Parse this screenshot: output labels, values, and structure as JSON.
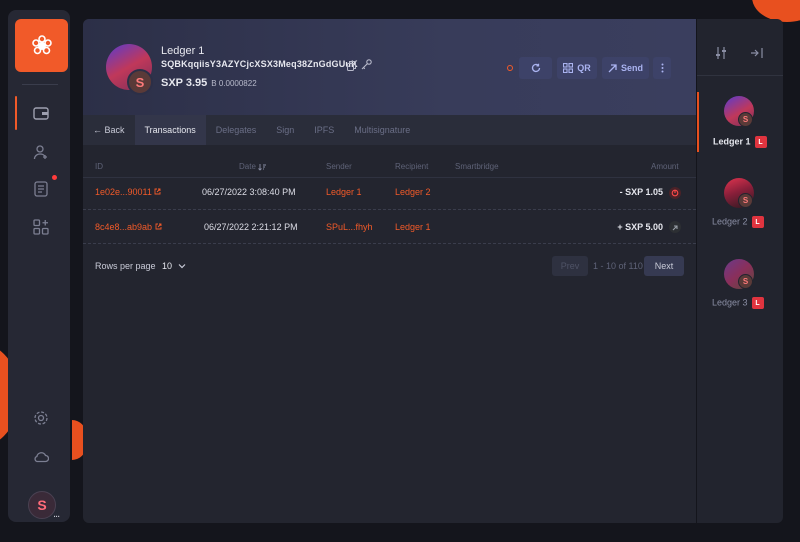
{
  "colors": {
    "accent": "#f15a29",
    "badge_red": "#e0343f",
    "button_bg": "#3d4268"
  },
  "wallet": {
    "name": "Ledger 1",
    "address": "SQBKqqiisY3AZYCjcXSX3Meq38ZnGdGUuK",
    "balance": "SXP 3.95",
    "btc": "B 0.0000822",
    "avatar_letter": "S"
  },
  "header_buttons": {
    "refresh_icon": "refresh-icon",
    "qr": "QR",
    "send": "Send",
    "more_icon": "more-vertical-icon"
  },
  "tabs": [
    {
      "label": "← Back"
    },
    {
      "label": "Transactions"
    },
    {
      "label": "Delegates"
    },
    {
      "label": "Sign"
    },
    {
      "label": "IPFS"
    },
    {
      "label": "Multisignature"
    }
  ],
  "table": {
    "headers": {
      "id": "ID",
      "date": "Date",
      "sender": "Sender",
      "recipient": "Recipient",
      "smartbridge": "Smartbridge",
      "amount": "Amount"
    },
    "rows": [
      {
        "id": "1e02e...90011",
        "date": "06/27/2022 3:08:40 PM",
        "sender": "Ledger 1",
        "recipient": "Ledger 2",
        "amount": "- SXP 1.05"
      },
      {
        "id": "8c4e8...ab9ab",
        "date": "06/27/2022 2:21:12 PM",
        "sender": "SPuL...fhyh",
        "recipient": "Ledger 1",
        "amount": "+ SXP 5.00"
      }
    ]
  },
  "pagination": {
    "rows_label": "Rows per page",
    "rows_value": "10",
    "prev": "Prev",
    "info": "1 - 10 of 110",
    "next": "Next"
  },
  "sidebar_user": {
    "letter": "S",
    "more": "..."
  },
  "wallets": [
    {
      "label": "Ledger 1",
      "badge": "L",
      "letter": "S"
    },
    {
      "label": "Ledger 2",
      "badge": "L",
      "letter": "S"
    },
    {
      "label": "Ledger 3",
      "badge": "L",
      "letter": "S"
    }
  ]
}
